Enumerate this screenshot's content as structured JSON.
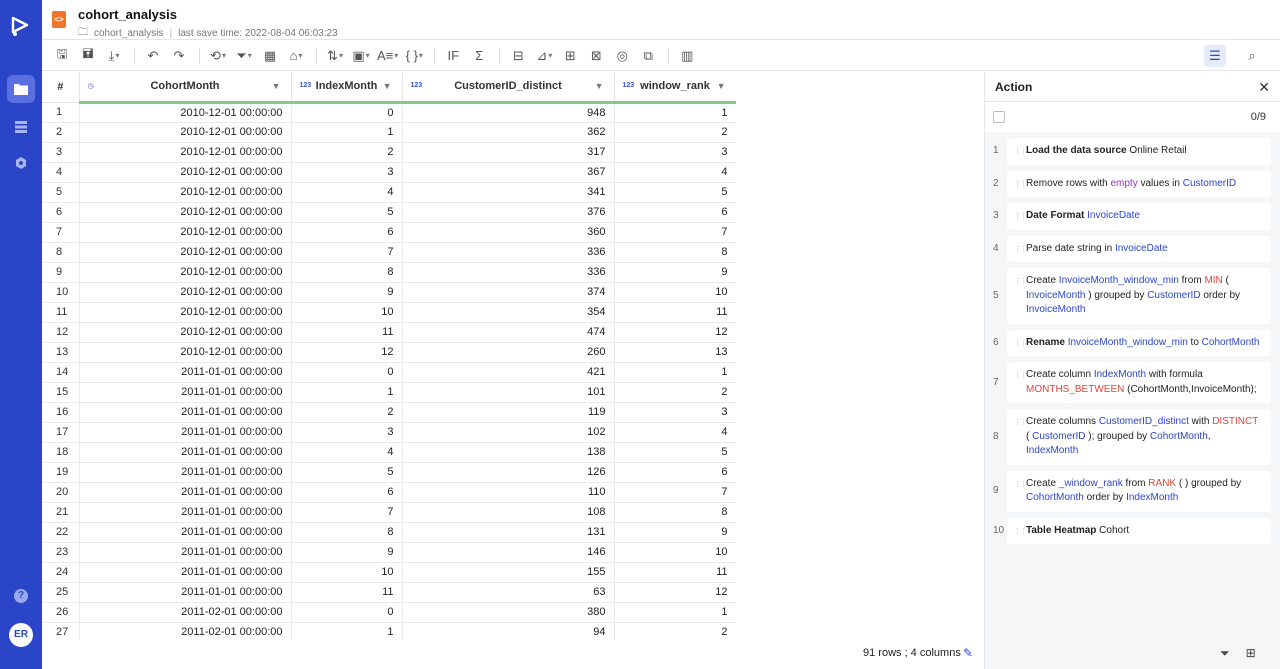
{
  "rail": {
    "avatar": "ER",
    "help": "?"
  },
  "header": {
    "title": "cohort_analysis",
    "folder": "cohort_analysis",
    "save_time": "last save time: 2022-08-04 06:03:23"
  },
  "grid": {
    "columns": [
      {
        "label": "",
        "type": ""
      },
      {
        "label": "CohortMonth",
        "type": "date"
      },
      {
        "label": "IndexMonth",
        "type": "123"
      },
      {
        "label": "CustomerID_distinct",
        "type": "123"
      },
      {
        "label": "window_rank",
        "type": "123"
      }
    ],
    "rows": [
      [
        "1",
        "2010-12-01 00:00:00",
        "0",
        "948",
        "1"
      ],
      [
        "2",
        "2010-12-01 00:00:00",
        "1",
        "362",
        "2"
      ],
      [
        "3",
        "2010-12-01 00:00:00",
        "2",
        "317",
        "3"
      ],
      [
        "4",
        "2010-12-01 00:00:00",
        "3",
        "367",
        "4"
      ],
      [
        "5",
        "2010-12-01 00:00:00",
        "4",
        "341",
        "5"
      ],
      [
        "6",
        "2010-12-01 00:00:00",
        "5",
        "376",
        "6"
      ],
      [
        "7",
        "2010-12-01 00:00:00",
        "6",
        "360",
        "7"
      ],
      [
        "8",
        "2010-12-01 00:00:00",
        "7",
        "336",
        "8"
      ],
      [
        "9",
        "2010-12-01 00:00:00",
        "8",
        "336",
        "9"
      ],
      [
        "10",
        "2010-12-01 00:00:00",
        "9",
        "374",
        "10"
      ],
      [
        "11",
        "2010-12-01 00:00:00",
        "10",
        "354",
        "11"
      ],
      [
        "12",
        "2010-12-01 00:00:00",
        "11",
        "474",
        "12"
      ],
      [
        "13",
        "2010-12-01 00:00:00",
        "12",
        "260",
        "13"
      ],
      [
        "14",
        "2011-01-01 00:00:00",
        "0",
        "421",
        "1"
      ],
      [
        "15",
        "2011-01-01 00:00:00",
        "1",
        "101",
        "2"
      ],
      [
        "16",
        "2011-01-01 00:00:00",
        "2",
        "119",
        "3"
      ],
      [
        "17",
        "2011-01-01 00:00:00",
        "3",
        "102",
        "4"
      ],
      [
        "18",
        "2011-01-01 00:00:00",
        "4",
        "138",
        "5"
      ],
      [
        "19",
        "2011-01-01 00:00:00",
        "5",
        "126",
        "6"
      ],
      [
        "20",
        "2011-01-01 00:00:00",
        "6",
        "110",
        "7"
      ],
      [
        "21",
        "2011-01-01 00:00:00",
        "7",
        "108",
        "8"
      ],
      [
        "22",
        "2011-01-01 00:00:00",
        "8",
        "131",
        "9"
      ],
      [
        "23",
        "2011-01-01 00:00:00",
        "9",
        "146",
        "10"
      ],
      [
        "24",
        "2011-01-01 00:00:00",
        "10",
        "155",
        "11"
      ],
      [
        "25",
        "2011-01-01 00:00:00",
        "11",
        "63",
        "12"
      ],
      [
        "26",
        "2011-02-01 00:00:00",
        "0",
        "380",
        "1"
      ],
      [
        "27",
        "2011-02-01 00:00:00",
        "1",
        "94",
        "2"
      ]
    ]
  },
  "panel": {
    "title": "Action",
    "count": "0/9",
    "steps": [
      {
        "num": "1",
        "parts": [
          [
            "b",
            "Load the data source"
          ],
          [
            "t",
            " Online Retail"
          ]
        ]
      },
      {
        "num": "2",
        "parts": [
          [
            "t",
            "Remove rows with "
          ],
          [
            "p",
            "empty"
          ],
          [
            "t",
            " values in "
          ],
          [
            "c",
            "CustomerID"
          ]
        ]
      },
      {
        "num": "3",
        "parts": [
          [
            "b",
            "Date Format"
          ],
          [
            "t",
            "  "
          ],
          [
            "c",
            "InvoiceDate"
          ]
        ]
      },
      {
        "num": "4",
        "parts": [
          [
            "t",
            "Parse date string in "
          ],
          [
            "c",
            "InvoiceDate"
          ]
        ]
      },
      {
        "num": "5",
        "parts": [
          [
            "t",
            "Create "
          ],
          [
            "c",
            "InvoiceMonth_window_min"
          ],
          [
            "t",
            " from "
          ],
          [
            "r",
            "MIN"
          ],
          [
            "t",
            " ( "
          ],
          [
            "c",
            "InvoiceMonth"
          ],
          [
            "t",
            " ) grouped by "
          ],
          [
            "c",
            "CustomerID"
          ],
          [
            "t",
            " order by "
          ],
          [
            "c",
            "InvoiceMonth"
          ]
        ]
      },
      {
        "num": "6",
        "parts": [
          [
            "b",
            "Rename"
          ],
          [
            "t",
            "   "
          ],
          [
            "c",
            "InvoiceMonth_window_min"
          ],
          [
            "t",
            " to "
          ],
          [
            "c",
            "CohortMonth"
          ]
        ]
      },
      {
        "num": "7",
        "parts": [
          [
            "t",
            "Create column "
          ],
          [
            "c",
            "IndexMonth"
          ],
          [
            "t",
            " with formula "
          ],
          [
            "r",
            "MONTHS_BETWEEN"
          ],
          [
            "t",
            " (CohortMonth,InvoiceMonth);"
          ]
        ]
      },
      {
        "num": "8",
        "parts": [
          [
            "t",
            "Create columns "
          ],
          [
            "c",
            "CustomerID_distinct"
          ],
          [
            "t",
            " with "
          ],
          [
            "r",
            "DISTINCT"
          ],
          [
            "t",
            " ( "
          ],
          [
            "c",
            "CustomerID"
          ],
          [
            "t",
            " ); grouped by "
          ],
          [
            "c",
            "CohortMonth"
          ],
          [
            "t",
            ", "
          ],
          [
            "c",
            "IndexMonth"
          ]
        ]
      },
      {
        "num": "9",
        "parts": [
          [
            "t",
            "Create "
          ],
          [
            "c",
            "_window_rank"
          ],
          [
            "t",
            " from "
          ],
          [
            "r",
            "RANK"
          ],
          [
            "t",
            " ( ) grouped by "
          ],
          [
            "c",
            "CohortMonth"
          ],
          [
            "t",
            " order by "
          ],
          [
            "c",
            "IndexMonth"
          ]
        ]
      },
      {
        "num": "10",
        "parts": [
          [
            "b",
            "Table Heatmap"
          ],
          [
            "t",
            " Cohort"
          ]
        ]
      }
    ]
  },
  "footer": {
    "status": "91 rows ; 4 columns"
  },
  "colors": {
    "rail": "#2b45c9",
    "accent_green": "#86c98a",
    "link": "#2b45c9",
    "func": "#e0453a"
  }
}
